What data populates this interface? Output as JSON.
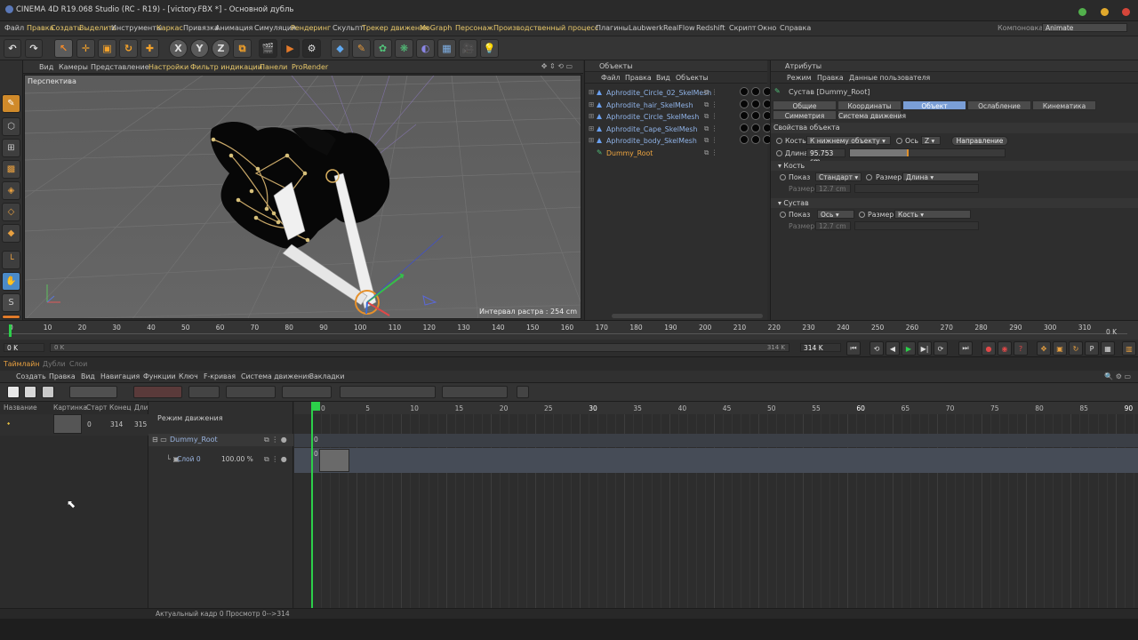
{
  "app": {
    "title": "CINEMA 4D R19.068 Studio (RC - R19) - [victory.FBX *] - Основной дубль"
  },
  "menubar": {
    "items": [
      "Файл",
      "Правка",
      "Создать",
      "Выделить",
      "Инструменты",
      "Каркас",
      "Привязка",
      "Анимация",
      "Симуляция",
      "Рендеринг",
      "Скульпт",
      "Трекер движения",
      "MoGraph",
      "Персонаж",
      "Производственный процесс",
      "Плагины",
      "Laubwerk",
      "RealFlow",
      "Redshift",
      "Скрипт",
      "Окно",
      "Справка"
    ],
    "layout_label": "Компоновка",
    "layout_value": "Animate"
  },
  "toolbar": {
    "axis_x": "X",
    "axis_y": "Y",
    "axis_z": "Z"
  },
  "viewport": {
    "menu": [
      "Вид",
      "Камеры",
      "Представление",
      "Настройки",
      "Фильтр индикации",
      "Панели",
      "ProRender"
    ],
    "label": "Перспектива",
    "info": "Интервал растра : 254 cm"
  },
  "objects": {
    "title": "Объекты",
    "menu": [
      "Файл",
      "Правка",
      "Вид",
      "Объекты"
    ],
    "items": [
      {
        "name": "Aphrodite_Circle_02_SkelMesh"
      },
      {
        "name": "Aphrodite_hair_SkelMesh"
      },
      {
        "name": "Aphrodite_Circle_SkelMesh"
      },
      {
        "name": "Aphrodite_Cape_SkelMesh"
      },
      {
        "name": "Aphrodite_body_SkelMesh"
      },
      {
        "name": "Dummy_Root"
      }
    ]
  },
  "attributes": {
    "title": "Атрибуты",
    "menu": [
      "Режим",
      "Правка",
      "Данные пользователя"
    ],
    "object_title": "Сустав [Dummy_Root]",
    "tabs_row1": [
      "Общие",
      "Координаты",
      "Объект",
      "Ослабление",
      "Кинематика"
    ],
    "tabs_row2": [
      "Симметрия",
      "Система движения"
    ],
    "active_tab": "Объект",
    "section": "Свойства объекта",
    "bone_label": "Кость",
    "bone_value": "К нижнему объекту",
    "axis_label": "Ось",
    "axis_value": "Z",
    "direction_btn": "Направление",
    "length_label": "Длина",
    "length_value": "95.753 cm",
    "group_bone": "Кость",
    "show_label": "Показ",
    "show_value": "Стандарт",
    "size_label": "Размер",
    "size_value": "Длина",
    "size_field_label": "Размер",
    "size_field_value": "12.7 cm",
    "group_joint": "Сустав",
    "joint_show_label": "Показ",
    "joint_show_value": "Ось",
    "joint_size_label": "Размер",
    "joint_size_value": "Кость",
    "joint_size_field_label": "Размер",
    "joint_size_field_value": "12.7 cm"
  },
  "ruler": {
    "ticks": [
      "0",
      "10",
      "20",
      "30",
      "40",
      "50",
      "60",
      "70",
      "80",
      "90",
      "100",
      "110",
      "120",
      "130",
      "140",
      "150",
      "160",
      "170",
      "180",
      "190",
      "200",
      "210",
      "220",
      "230",
      "240",
      "250",
      "260",
      "270",
      "280",
      "290",
      "300",
      "310"
    ],
    "end_value": "0 K"
  },
  "transport": {
    "current": "0 K",
    "range_start": "0 K",
    "range_end_inner": "314 K",
    "range_end": "314 K"
  },
  "timeline": {
    "tabs": [
      "Таймлайн",
      "Дубли",
      "Слои"
    ],
    "menu": [
      "Создать",
      "Правка",
      "Вид",
      "Навигация",
      "Функции",
      "Ключ",
      "F-кривая",
      "Система движения",
      "Закладки"
    ],
    "columns": [
      "Название",
      "Картинка",
      "Старт",
      "Конец",
      "Длит"
    ],
    "row": {
      "start": "0",
      "end": "314",
      "dur": "315"
    },
    "mode_label": "Режим движения",
    "tree_root": "Dummy_Root",
    "tree_layer": "Слой 0",
    "tree_layer_pct": "100.00 %",
    "ticks": [
      "0",
      "5",
      "10",
      "15",
      "20",
      "25",
      "30",
      "35",
      "40",
      "45",
      "50",
      "55",
      "60",
      "65",
      "70",
      "75",
      "80",
      "85",
      "90"
    ],
    "row0_label": "0",
    "row1_label": "0"
  },
  "status": {
    "text": "Актуальный кадр  0  Просмотр  0-->314"
  }
}
